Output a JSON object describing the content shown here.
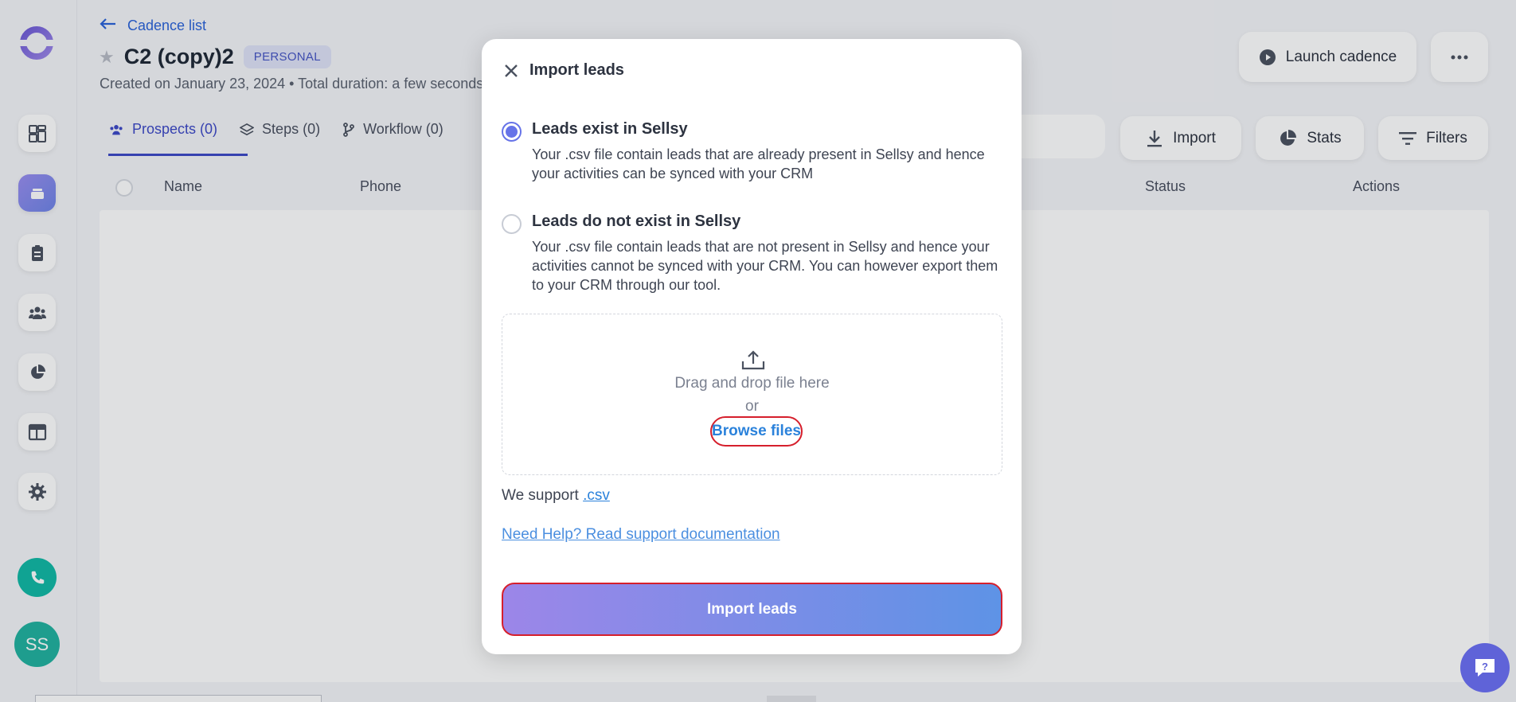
{
  "header": {
    "back_label": "Cadence list",
    "title": "C2 (copy)2",
    "badge": "PERSONAL",
    "subtitle": "Created on January 23, 2024 • Total duration: a few seconds",
    "launch_label": "Launch cadence"
  },
  "tabs": [
    {
      "label": "Prospects (0)"
    },
    {
      "label": "Steps (0)"
    },
    {
      "label": "Workflow (0)"
    }
  ],
  "toolbar": {
    "import_label": "Import",
    "stats_label": "Stats",
    "filters_label": "Filters"
  },
  "table": {
    "columns": [
      "Name",
      "Phone",
      "Status",
      "Actions"
    ]
  },
  "sidebar": {
    "avatar_initials": "SS"
  },
  "modal": {
    "title": "Import leads",
    "options": [
      {
        "title": "Leads exist in Sellsy",
        "description": "Your .csv file contain leads that are already present in Sellsy and hence your activities can be synced with your CRM",
        "selected": true
      },
      {
        "title": "Leads do not exist in Sellsy",
        "description": "Your .csv file contain leads that are not present in Sellsy and hence your activities cannot be synced with your CRM. You can however export them to your CRM through our tool.",
        "selected": false
      }
    ],
    "dropzone": {
      "drag_text": "Drag and drop file here",
      "or_text": "or",
      "browse_label": "Browse files"
    },
    "support_prefix": "We support",
    "support_format": ".csv",
    "help_link": "Need Help? Read support documentation",
    "submit_label": "Import leads"
  },
  "colors": {
    "accent": "#3d49c7",
    "link": "#2b82db",
    "highlight": "#d61f2c",
    "teal": "#12b9a6"
  }
}
